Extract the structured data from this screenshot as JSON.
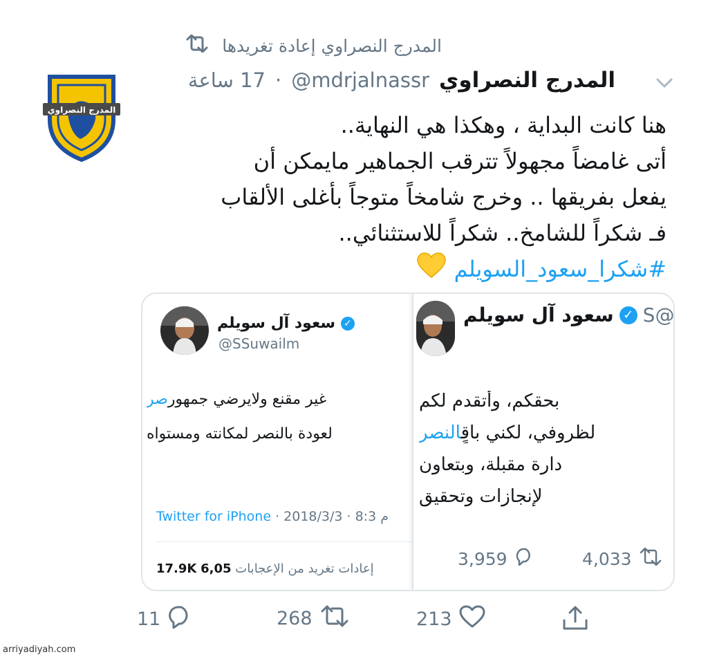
{
  "retweet": {
    "text": "المدرج النصراوي إعادة تغريدها",
    "icon": "retweet-icon"
  },
  "tweet": {
    "author_name": "المدرج النصراوي",
    "handle": "@mdrjalnassr",
    "separator": "·",
    "time": "17 ساعة",
    "avatar_label": "المدرج النصراوي",
    "lines": [
      "هنا كانت البداية ، وهكذا هي النهاية..",
      "أتى غامضاً مجهولاً تترقب الجماهير مايمكن أن",
      "يفعل بفريقها .. وخرج شامخاً متوجاً بأغلى الألقاب",
      "فـ شكراً للشامخ.. شكراً للاستثنائي.."
    ],
    "hashtag": "#شكرا_سعود_السويلم",
    "emoji": "💛"
  },
  "quote_left": {
    "name": "سعود آل سويلم",
    "handle": "@SSuwailm",
    "line1_blue": "صر",
    "line1": " غير مقنع ولايرضي  جمهور",
    "line2": "لعودة بالنصر  لمكانته ومستواه",
    "source": "Twitter for iPhone",
    "date": " · 2018/3/3 · ",
    "time": "8:3 م",
    "retweets_count": "17.9K",
    "retweets_label": "إعادات تغريد",
    "likes_label": "من الإعجابات",
    "likes_count": "6,05"
  },
  "quote_right": {
    "name": "سعود آل سويلم",
    "handle": "@S",
    "line1": "بحقكم، وأتقدم لكم",
    "line2_blue": "النصر",
    "line2": " لظروفي، لكني باقٍ",
    "line3": "دارة مقبلة، وبتعاون",
    "line4": "لإنجازات وتحقيق",
    "replies": "3,959",
    "retweets": "4,033"
  },
  "actions": {
    "replies": "11",
    "retweets": "268",
    "likes": "213"
  },
  "watermark": "arriyadiyah.com",
  "colors": {
    "accent": "#1da1f2",
    "muted": "#657786",
    "text": "#14171a",
    "logo_yellow": "#f5c400",
    "logo_blue": "#1f4fa0"
  }
}
